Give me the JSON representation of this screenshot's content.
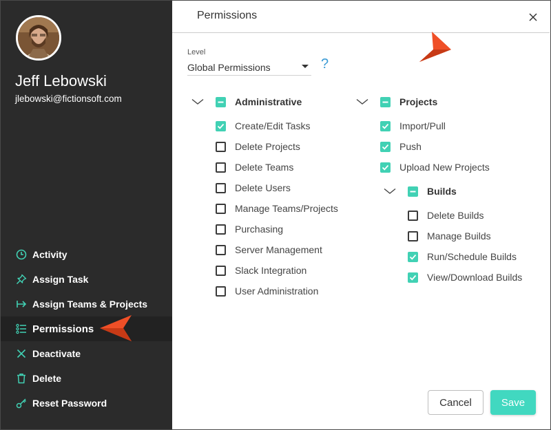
{
  "colors": {
    "accent": "#41d1b4",
    "sidebar_bg": "#2b2b2b",
    "pointer": "#ef4f27",
    "help": "#3a9bd5"
  },
  "user": {
    "name": "Jeff Lebowski",
    "email": "jlebowski@fictionsoft.com"
  },
  "sidebar": {
    "items": [
      {
        "label": "Activity",
        "icon": "clock-icon"
      },
      {
        "label": "Assign Task",
        "icon": "pin-icon"
      },
      {
        "label": "Assign Teams & Projects",
        "icon": "arrow-right-icon"
      },
      {
        "label": "Permissions",
        "icon": "list-icon",
        "active": true
      },
      {
        "label": "Deactivate",
        "icon": "x-icon"
      },
      {
        "label": "Delete",
        "icon": "trash-icon"
      },
      {
        "label": "Reset Password",
        "icon": "key-icon"
      }
    ]
  },
  "dialog": {
    "title": "Permissions",
    "level_label": "Level",
    "level_value": "Global Permissions",
    "help": "?",
    "cancel_label": "Cancel",
    "save_label": "Save"
  },
  "permissions": {
    "administrative": {
      "label": "Administrative",
      "state": "partial",
      "items": [
        {
          "label": "Create/Edit Tasks",
          "checked": true
        },
        {
          "label": "Delete Projects",
          "checked": false
        },
        {
          "label": "Delete Teams",
          "checked": false
        },
        {
          "label": "Delete Users",
          "checked": false
        },
        {
          "label": "Manage Teams/Projects",
          "checked": false
        },
        {
          "label": "Purchasing",
          "checked": false
        },
        {
          "label": "Server Management",
          "checked": false
        },
        {
          "label": "Slack Integration",
          "checked": false
        },
        {
          "label": "User Administration",
          "checked": false
        }
      ]
    },
    "projects": {
      "label": "Projects",
      "state": "partial",
      "items": [
        {
          "label": "Import/Pull",
          "checked": true
        },
        {
          "label": "Push",
          "checked": true
        },
        {
          "label": "Upload New Projects",
          "checked": true
        }
      ]
    },
    "builds": {
      "label": "Builds",
      "state": "partial",
      "items": [
        {
          "label": "Delete Builds",
          "checked": false
        },
        {
          "label": "Manage Builds",
          "checked": false
        },
        {
          "label": "Run/Schedule Builds",
          "checked": true
        },
        {
          "label": "View/Download Builds",
          "checked": true
        }
      ]
    }
  }
}
